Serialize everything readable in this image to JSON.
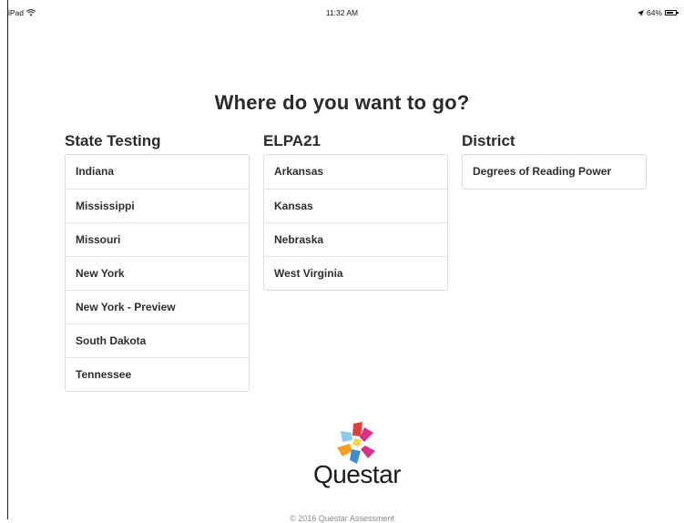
{
  "status_bar": {
    "device": "iPad",
    "time": "11:32 AM",
    "battery": "64%"
  },
  "title": "Where do you want to go?",
  "columns": [
    {
      "heading": "State Testing",
      "items": [
        "Indiana",
        "Mississippi",
        "Missouri",
        "New York",
        "New York - Preview",
        "South Dakota",
        "Tennessee"
      ]
    },
    {
      "heading": "ELPA21",
      "items": [
        "Arkansas",
        "Kansas",
        "Nebraska",
        "West Virginia"
      ]
    },
    {
      "heading": "District",
      "items": [
        "Degrees of Reading Power"
      ]
    }
  ],
  "logo": {
    "wordmark": "Questar",
    "colors": [
      "#e0403a",
      "#f4a024",
      "#3b8fd0",
      "#d8318a",
      "#8cc9e8",
      "#f6d34a"
    ]
  },
  "footer": {
    "copyright": "© 2016 Questar Assessment"
  }
}
